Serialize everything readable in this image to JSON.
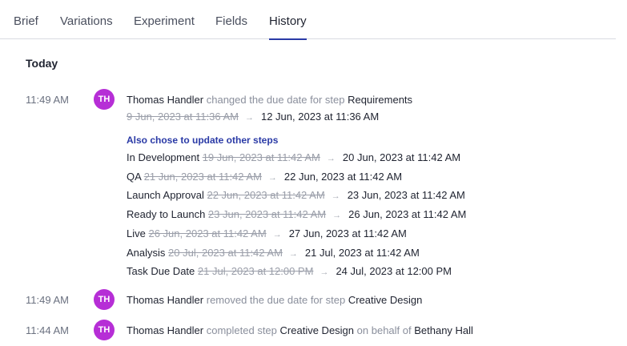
{
  "tabs": [
    {
      "label": "Brief",
      "active": false
    },
    {
      "label": "Variations",
      "active": false
    },
    {
      "label": "Experiment",
      "active": false
    },
    {
      "label": "Fields",
      "active": false
    },
    {
      "label": "History",
      "active": true
    }
  ],
  "day_heading": "Today",
  "entries": [
    {
      "time": "11:49 AM",
      "avatar": "TH",
      "actor": "Thomas Handler",
      "action": "changed the due date for step",
      "target": "Requirements",
      "old_value": "9 Jun, 2023 at 11:36 AM",
      "new_value": "12 Jun, 2023 at 11:36 AM",
      "also_heading": "Also chose to update other steps",
      "updates": [
        {
          "step": "In Development",
          "old": "19 Jun, 2023 at 11:42 AM",
          "new": "20 Jun, 2023 at 11:42 AM"
        },
        {
          "step": "QA",
          "old": "21 Jun, 2023 at 11:42 AM",
          "new": "22 Jun, 2023 at 11:42 AM"
        },
        {
          "step": "Launch Approval",
          "old": "22 Jun, 2023 at 11:42 AM",
          "new": "23 Jun, 2023 at 11:42 AM"
        },
        {
          "step": "Ready to Launch",
          "old": "23 Jun, 2023 at 11:42 AM",
          "new": "26 Jun, 2023 at 11:42 AM"
        },
        {
          "step": "Live",
          "old": "26 Jun, 2023 at 11:42 AM",
          "new": "27 Jun, 2023 at 11:42 AM"
        },
        {
          "step": "Analysis",
          "old": "20 Jul, 2023 at 11:42 AM",
          "new": "21 Jul, 2023 at 11:42 AM"
        },
        {
          "step": "Task Due Date",
          "old": "21 Jul, 2023 at 12:00 PM",
          "new": "24 Jul, 2023 at 12:00 PM"
        }
      ]
    },
    {
      "time": "11:49 AM",
      "avatar": "TH",
      "actor": "Thomas Handler",
      "action": "removed the due date for step",
      "target": "Creative Design"
    },
    {
      "time": "11:44 AM",
      "avatar": "TH",
      "actor": "Thomas Handler",
      "action": "completed step",
      "target": "Creative Design",
      "suffix": "on behalf of",
      "behalf": "Bethany Hall"
    }
  ],
  "colors": {
    "accent": "#2a3aa6",
    "avatar": "#b62ed6",
    "muted_text": "#8a8f9c"
  },
  "icons": {
    "arrow": "arrow-right-icon"
  }
}
